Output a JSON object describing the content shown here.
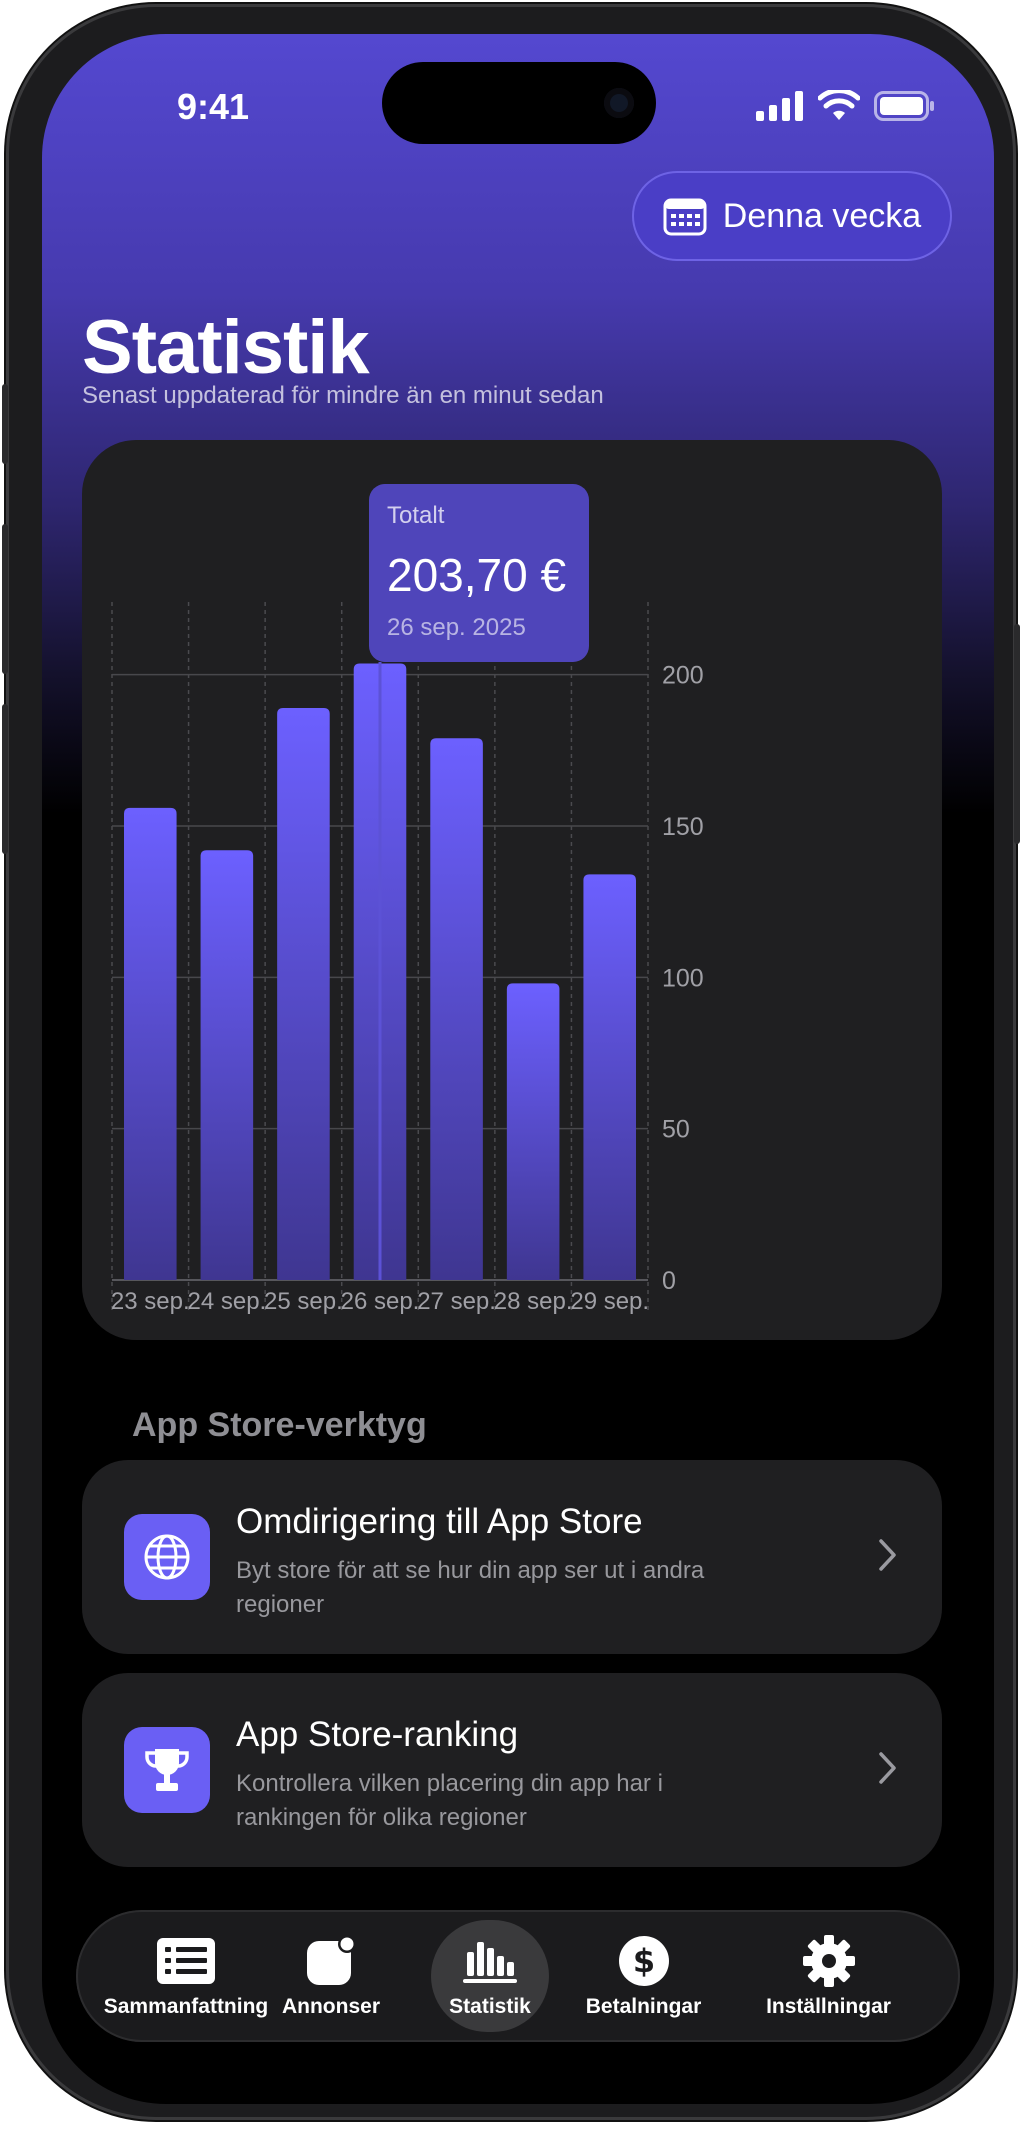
{
  "status": {
    "time": "9:41"
  },
  "header": {
    "date_filter_label": "Denna vecka",
    "title": "Statistik",
    "subtitle": "Senast uppdaterad för mindre än en minut sedan"
  },
  "tooltip": {
    "label": "Totalt",
    "value": "203,70 €",
    "date": "26 sep. 2025"
  },
  "chart_data": {
    "type": "bar",
    "categories": [
      "23 sep.",
      "24 sep.",
      "25 sep.",
      "26 sep.",
      "27 sep.",
      "28 sep.",
      "29 sep."
    ],
    "values": [
      156,
      142,
      189,
      203.7,
      179,
      98,
      134
    ],
    "ylim": [
      0,
      224
    ],
    "yticks": [
      0,
      50,
      100,
      150,
      200
    ],
    "selected_index": 3,
    "grid": true,
    "bar_color": "#6c60ff"
  },
  "tools": {
    "section_title": "App Store-verktyg",
    "items": [
      {
        "title": "Omdirigering till App Store",
        "description": "Byt store för att se hur din app ser ut i andra regioner",
        "icon": "globe-icon"
      },
      {
        "title": "App Store-ranking",
        "description": "Kontrollera vilken placering din app har i rankingen för olika regioner",
        "icon": "trophy-icon"
      }
    ]
  },
  "tabbar": {
    "items": [
      {
        "label": "Sammanfattning",
        "icon": "list-icon"
      },
      {
        "label": "Annonser",
        "icon": "app-badge-icon"
      },
      {
        "label": "Statistik",
        "icon": "chart-icon",
        "active": true
      },
      {
        "label": "Betalningar",
        "icon": "dollar-icon"
      },
      {
        "label": "Inställningar",
        "icon": "gear-icon"
      }
    ]
  },
  "colors": {
    "accent": "#6a5ff4",
    "header_gradient_top": "#5448d0"
  }
}
